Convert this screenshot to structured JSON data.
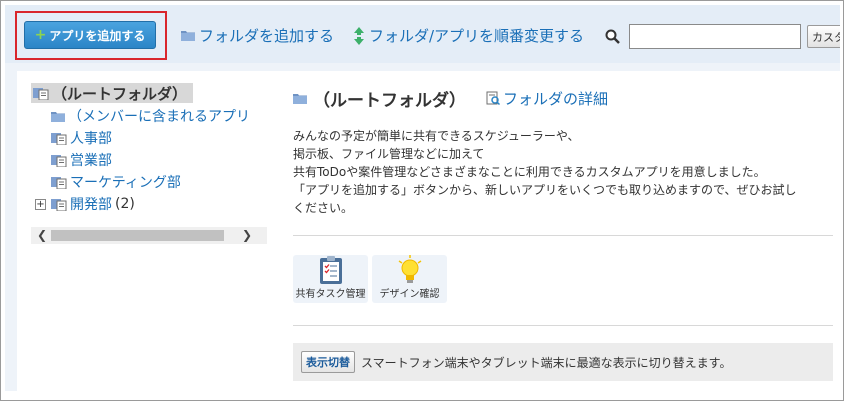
{
  "toolbar": {
    "add_app_label": "アプリを追加する",
    "add_folder_label": "フォルダを追加する",
    "reorder_label": "フォルダ/アプリを順番変更する",
    "search_value": "",
    "search_button_label": "カスタム"
  },
  "tree": {
    "root_label": "（ルートフォルダ）",
    "items": [
      {
        "label": "（メンバーに含まれるアプリ"
      },
      {
        "label": "人事部"
      },
      {
        "label": "営業部"
      },
      {
        "label": "マーケティング部"
      },
      {
        "label": "開発部",
        "count": "(2)"
      }
    ]
  },
  "content": {
    "title": "（ルートフォルダ）",
    "detail_link": "フォルダの詳細",
    "description": [
      "みんなの予定が簡単に共有できるスケジューラーや、",
      "掲示板、ファイル管理などに加えて",
      "共有ToDoや案件管理などさまざまなことに利用できるカスタムアプリを用意しました。",
      "「アプリを追加する」ボタンから、新しいアプリをいくつでも取り込めますので、ぜひお試し",
      "ください。"
    ],
    "apps": [
      {
        "label": "共有タスク管理",
        "icon": "clipboard-icon"
      },
      {
        "label": "デザイン確認",
        "icon": "lightbulb-icon"
      }
    ],
    "switch_button": "表示切替",
    "switch_text": "スマートフォン端末やタブレット端末に最適な表示に切り替えます。"
  },
  "colors": {
    "accent": "#2b85c7",
    "link": "#1a6fb7",
    "highlight": "#d9262c",
    "panel_bg": "#eef3f9"
  }
}
